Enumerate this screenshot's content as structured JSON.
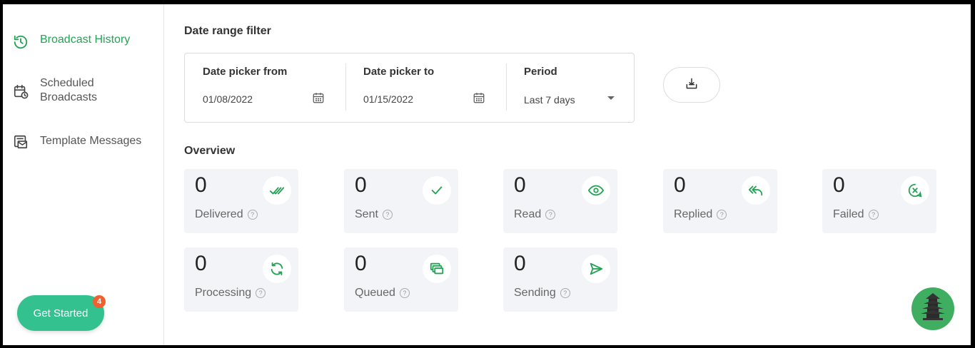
{
  "sidebar": {
    "items": [
      {
        "label": "Broadcast History",
        "icon": "history-icon",
        "active": true
      },
      {
        "label": "Scheduled Broadcasts",
        "icon": "calendar-clock-icon",
        "active": false
      },
      {
        "label": "Template Messages",
        "icon": "template-message-icon",
        "active": false
      }
    ],
    "get_started": {
      "label": "Get Started",
      "badge": "4"
    }
  },
  "filter": {
    "title": "Date range filter",
    "from": {
      "label": "Date picker from",
      "value": "01/08/2022"
    },
    "to": {
      "label": "Date picker to",
      "value": "01/15/2022"
    },
    "period": {
      "label": "Period",
      "value": "Last 7 days"
    }
  },
  "overview": {
    "title": "Overview",
    "cards": [
      {
        "value": "0",
        "label": "Delivered",
        "icon": "double-check-icon"
      },
      {
        "value": "0",
        "label": "Sent",
        "icon": "check-icon"
      },
      {
        "value": "0",
        "label": "Read",
        "icon": "eye-icon"
      },
      {
        "value": "0",
        "label": "Replied",
        "icon": "reply-all-icon"
      },
      {
        "value": "0",
        "label": "Failed",
        "icon": "failed-icon"
      },
      {
        "value": "0",
        "label": "Processing",
        "icon": "refresh-icon"
      },
      {
        "value": "0",
        "label": "Queued",
        "icon": "queue-icon"
      },
      {
        "value": "0",
        "label": "Sending",
        "icon": "send-icon"
      }
    ]
  },
  "help_glyph": "?",
  "colors": {
    "accent": "#23a455",
    "button": "#33c18f",
    "badge": "#f0612f",
    "card_bg": "#f3f4f7"
  }
}
